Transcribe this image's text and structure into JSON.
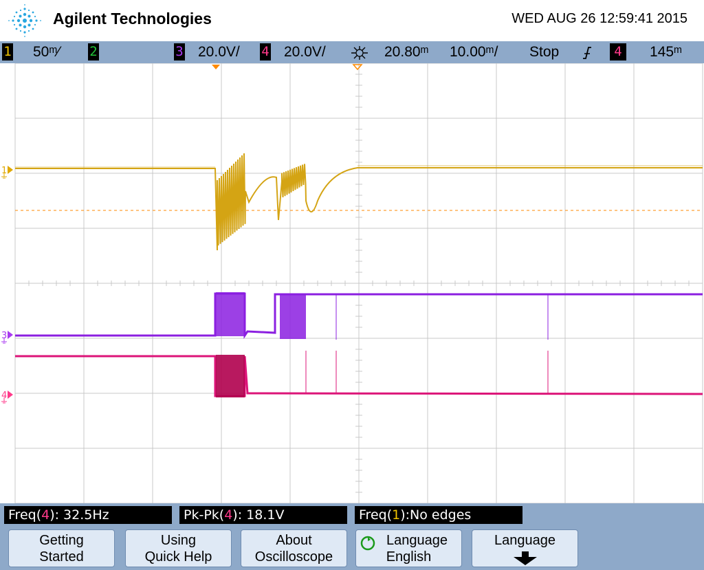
{
  "header": {
    "brand": "Agilent Technologies",
    "datetime": "WED AUG 26 12:59:41 2015"
  },
  "statusbar": {
    "ch1": {
      "num": "1",
      "scale": "50ᵐ⁄",
      "color": "#f0c400"
    },
    "ch2": {
      "num": "2",
      "color": "#22c43a"
    },
    "ch3": {
      "num": "3",
      "scale": "20.0V/",
      "color": "#a93af0"
    },
    "ch4": {
      "num": "4",
      "scale": "20.0V/",
      "color": "#ff3a8a"
    },
    "trigger_icon": "trigger-position-icon",
    "time_delay": "20.80ᵐ",
    "time_scale": "10.00ᵐ/",
    "run_state": "Stop",
    "slope_icon": "rising-edge-icon",
    "trig_source": "4",
    "trig_level": "145ᵐ"
  },
  "markers": {
    "ch1": "1",
    "ch3": "3",
    "ch4": "4"
  },
  "colors": {
    "ch1": "#d4a414",
    "ch3": "#8b1fe0",
    "ch4": "#dc1478",
    "grid": "#c9c9c9",
    "background": "#ffffff",
    "bar": "#8ea9c9"
  },
  "measurements": [
    {
      "label": "Freq(",
      "src": "4",
      "suffix": "): 32.5Hz",
      "src_color": "#ff3a8a"
    },
    {
      "label": "Pk-Pk(",
      "src": "4",
      "suffix": "): 18.1V",
      "src_color": "#ff3a8a"
    },
    {
      "label": "Freq(",
      "src": "1",
      "suffix": "):No edges",
      "src_color": "#f0c400"
    }
  ],
  "softkeys": [
    {
      "line1": "Getting",
      "line2": "Started"
    },
    {
      "line1": "Using",
      "line2": "Quick Help"
    },
    {
      "line1": "About",
      "line2": "Oscilloscope"
    },
    {
      "line1": "Language",
      "line2": "English"
    },
    {
      "line1": "Language",
      "line2": ""
    }
  ]
}
